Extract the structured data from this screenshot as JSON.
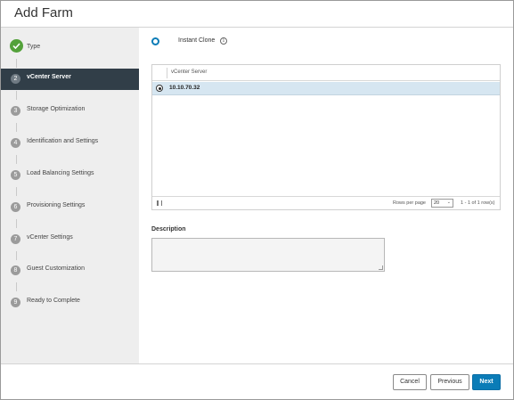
{
  "dialog": {
    "title": "Add Farm"
  },
  "steps": [
    {
      "number": "1",
      "label": "Type",
      "state": "done"
    },
    {
      "number": "2",
      "label": "vCenter Server",
      "state": "active"
    },
    {
      "number": "3",
      "label": "Storage Optimization",
      "state": "pending"
    },
    {
      "number": "4",
      "label": "Identification and Settings",
      "state": "pending"
    },
    {
      "number": "5",
      "label": "Load Balancing Settings",
      "state": "pending"
    },
    {
      "number": "6",
      "label": "Provisioning Settings",
      "state": "pending"
    },
    {
      "number": "7",
      "label": "vCenter Settings",
      "state": "pending"
    },
    {
      "number": "8",
      "label": "Guest Customization",
      "state": "pending"
    },
    {
      "number": "9",
      "label": "Ready to Complete",
      "state": "pending"
    }
  ],
  "clone_option": {
    "label": "Instant Clone",
    "selected": true,
    "info_icon": "info-icon"
  },
  "grid": {
    "column_header": "vCenter Server",
    "rows": [
      {
        "value": "10.10.70.32",
        "selected": true
      }
    ],
    "footer": {
      "rows_per_page_label": "Rows per page",
      "rows_per_page_value": "20",
      "page_info": "1 - 1 of 1 row(s)"
    }
  },
  "description": {
    "label": "Description",
    "value": ""
  },
  "buttons": {
    "cancel": "Cancel",
    "previous": "Previous",
    "next": "Next"
  },
  "colors": {
    "accent": "#0b7cb7",
    "sidebar_active": "#313e48",
    "step_done": "#53a13a",
    "row_selected": "#d6e6f1"
  }
}
